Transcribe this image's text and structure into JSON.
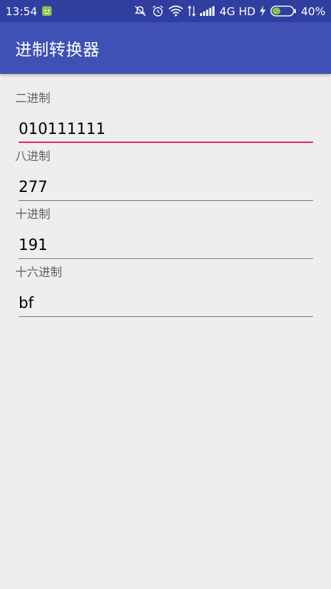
{
  "status_bar": {
    "time": "13:54",
    "network_label": "4G HD",
    "battery_percent": "40%",
    "battery_level": 0.4,
    "icons": [
      "notification-app-icon",
      "mute-icon",
      "alarm-icon",
      "wifi-icon",
      "data-arrows-icon",
      "signal-icon",
      "charging-icon",
      "battery-icon"
    ]
  },
  "app_bar": {
    "title": "进制转换器",
    "color": "#3f51b5"
  },
  "fields": [
    {
      "label": "二进制",
      "value": "010111111",
      "focused": true
    },
    {
      "label": "八进制",
      "value": "277",
      "focused": false
    },
    {
      "label": "十进制",
      "value": "191",
      "focused": false
    },
    {
      "label": "十六进制",
      "value": "bf",
      "focused": false
    }
  ],
  "colors": {
    "accent": "#e91e63",
    "primary": "#3f51b5",
    "primary_dark": "#303f9f"
  }
}
